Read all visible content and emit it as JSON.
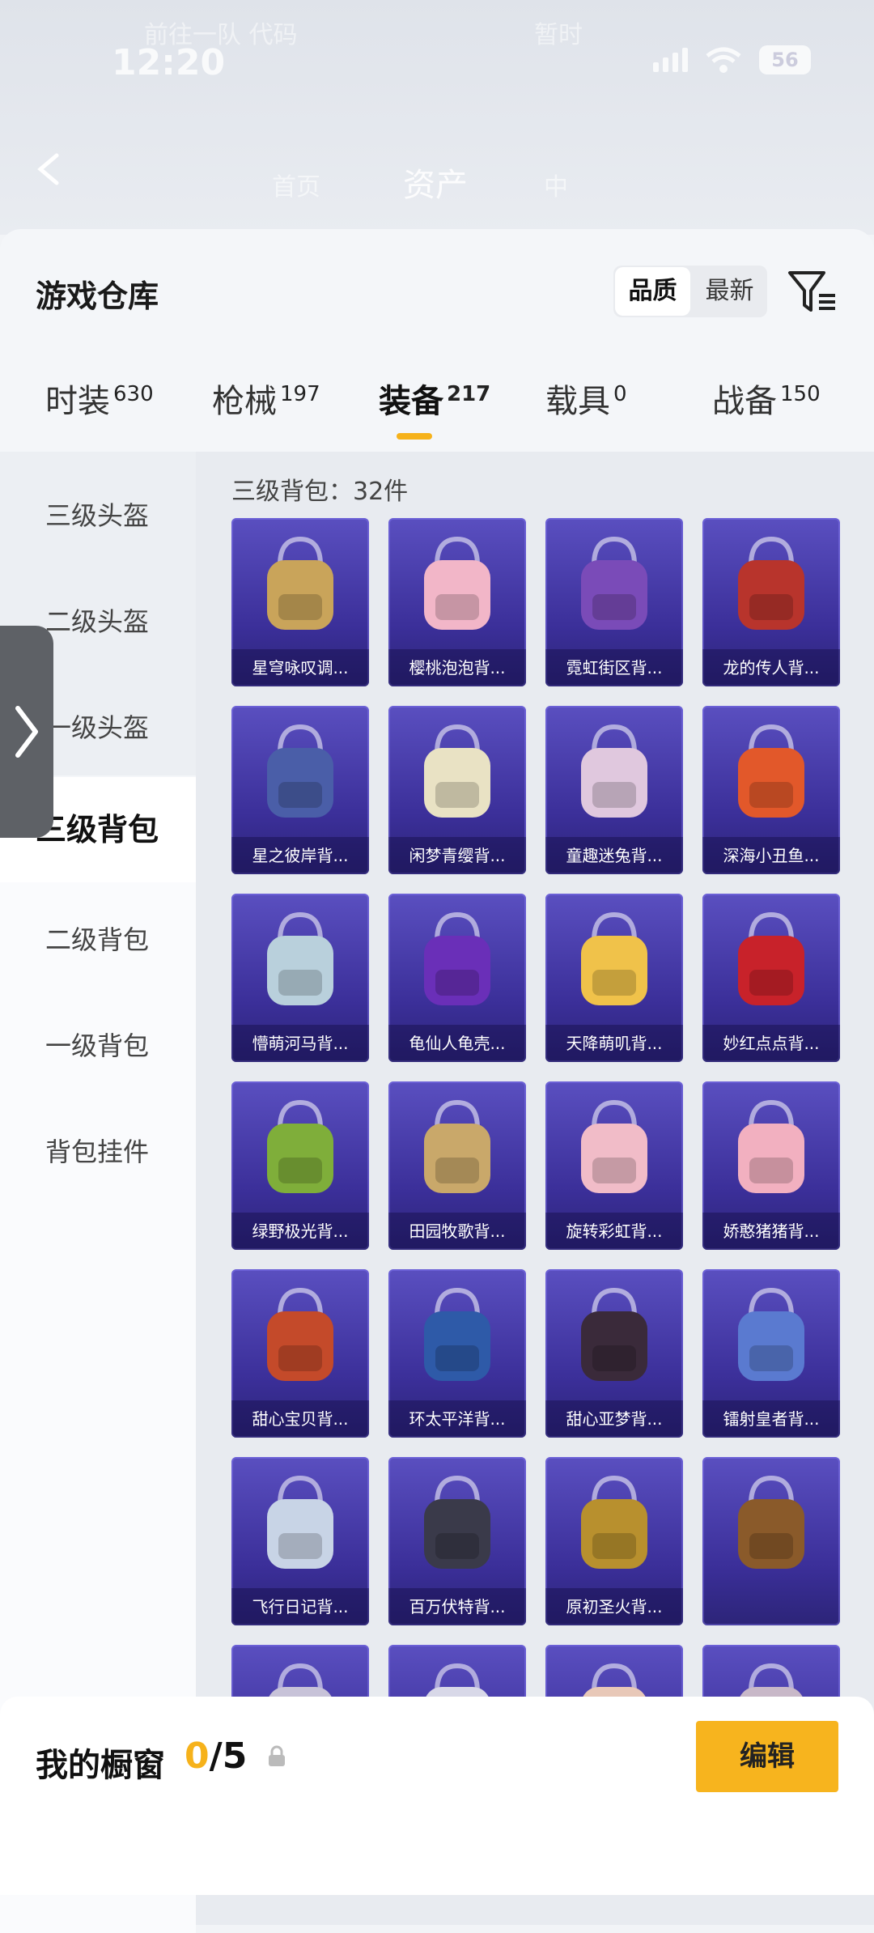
{
  "status_bar": {
    "time": "12:20",
    "battery": "56",
    "ghost_left": "前往一队 代码",
    "ghost_right": "暂时"
  },
  "nav": {
    "title": "资产",
    "ghost_left": "首页",
    "ghost_right": "中"
  },
  "card": {
    "title": "游戏仓库",
    "sort_options": [
      {
        "label": "品质",
        "active": true
      },
      {
        "label": "最新",
        "active": false
      }
    ]
  },
  "tabs": [
    {
      "label": "时装",
      "count": "630",
      "active": false
    },
    {
      "label": "枪械",
      "count": "197",
      "active": false
    },
    {
      "label": "装备",
      "count": "217",
      "active": true
    },
    {
      "label": "载具",
      "count": "0",
      "active": false
    },
    {
      "label": "战备",
      "count": "150",
      "active": false
    }
  ],
  "sidebar": [
    {
      "label": "三级头盔",
      "active": false
    },
    {
      "label": "二级头盔",
      "active": false
    },
    {
      "label": "一级头盔",
      "active": false
    },
    {
      "label": "三级背包",
      "active": true
    },
    {
      "label": "二级背包",
      "active": false
    },
    {
      "label": "一级背包",
      "active": false
    },
    {
      "label": "背包挂件",
      "active": false
    }
  ],
  "grid": {
    "header": "三级背包：32件",
    "items": [
      {
        "name": "星穹咏叹调...",
        "color": "#c9a45a"
      },
      {
        "name": "樱桃泡泡背...",
        "color": "#f2b6c8"
      },
      {
        "name": "霓虹街区背...",
        "color": "#7a4bb8"
      },
      {
        "name": "龙的传人背...",
        "color": "#b8342c"
      },
      {
        "name": "星之彼岸背...",
        "color": "#4a5ea8"
      },
      {
        "name": "闲梦青缨背...",
        "color": "#e9e2c4"
      },
      {
        "name": "童趣迷兔背...",
        "color": "#e0c8de"
      },
      {
        "name": "深海小丑鱼...",
        "color": "#e2582a"
      },
      {
        "name": "懵萌河马背...",
        "color": "#b9d0dc"
      },
      {
        "name": "龟仙人龟壳...",
        "color": "#6a2fb8"
      },
      {
        "name": "天降萌叽背...",
        "color": "#f0c24a"
      },
      {
        "name": "妙红点点背...",
        "color": "#c8222a"
      },
      {
        "name": "绿野极光背...",
        "color": "#7fae3a"
      },
      {
        "name": "田园牧歌背...",
        "color": "#c9a86a"
      },
      {
        "name": "旋转彩虹背...",
        "color": "#f1bcc8"
      },
      {
        "name": "娇憨猪猪背...",
        "color": "#f2b0c0"
      },
      {
        "name": "甜心宝贝背...",
        "color": "#c44a2a"
      },
      {
        "name": "环太平洋背...",
        "color": "#2e5aa8"
      },
      {
        "name": "甜心亚梦背...",
        "color": "#3a2a3a"
      },
      {
        "name": "镭射皇者背...",
        "color": "#5a7ad0"
      },
      {
        "name": "飞行日记背...",
        "color": "#c8d4e6"
      },
      {
        "name": "百万伏特背...",
        "color": "#3a3a4a"
      },
      {
        "name": "原初圣火背...",
        "color": "#b8902e"
      },
      {
        "name": "",
        "color": "#8a5a2a"
      },
      {
        "name": "",
        "color": "#c7c2d8"
      },
      {
        "name": "",
        "color": "#d8d8e8"
      },
      {
        "name": "",
        "color": "#e8c8b8"
      },
      {
        "name": "",
        "color": "#c8b8c8"
      }
    ]
  },
  "bottom": {
    "title": "我的橱窗",
    "current": "0",
    "total": "/5",
    "edit_label": "编辑"
  }
}
